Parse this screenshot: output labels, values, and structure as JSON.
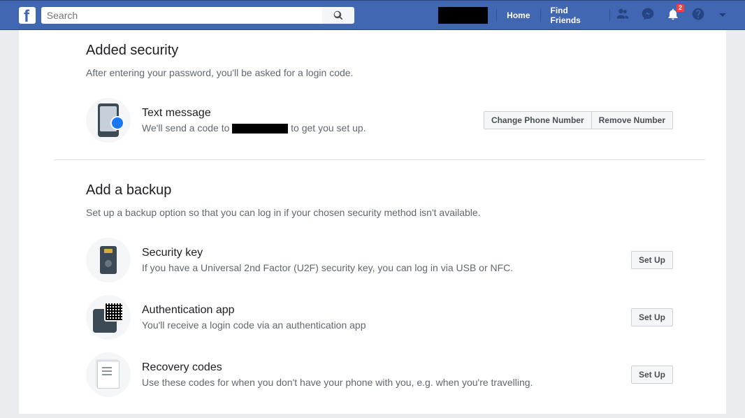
{
  "topbar": {
    "search_placeholder": "Search",
    "home": "Home",
    "find_friends": "Find Friends",
    "notification_count": "2"
  },
  "added_security": {
    "title": "Added security",
    "desc": "After entering your password, you'll be asked for a login code.",
    "sms": {
      "title": "Text message",
      "desc_prefix": "We'll send a code to ",
      "desc_suffix": " to get you set up.",
      "change_btn": "Change Phone Number",
      "remove_btn": "Remove Number"
    }
  },
  "backup": {
    "title": "Add a backup",
    "desc": "Set up a backup option so that you can log in if your chosen security method isn't available.",
    "key": {
      "title": "Security key",
      "desc": "If you have a Universal 2nd Factor (U2F) security key, you can log in via USB or NFC.",
      "btn": "Set Up"
    },
    "app": {
      "title": "Authentication app",
      "desc": "You'll receive a login code via an authentication app",
      "btn": "Set Up"
    },
    "codes": {
      "title": "Recovery codes",
      "desc": "Use these codes for when you don't have your phone with you, e.g. when you're travelling.",
      "btn": "Set Up"
    }
  }
}
